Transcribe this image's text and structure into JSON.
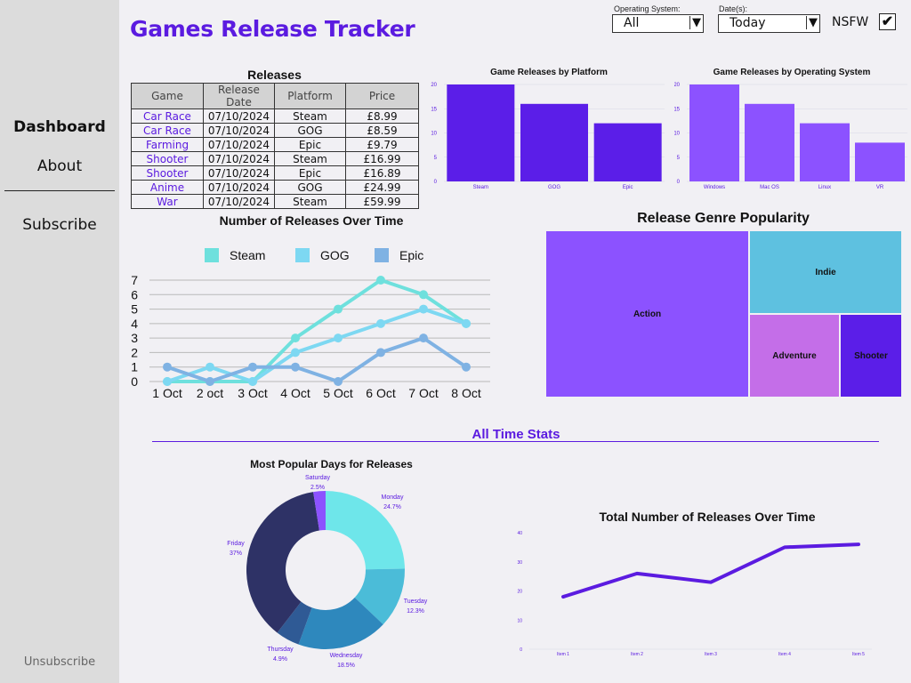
{
  "title": "Games Release Tracker",
  "nav": {
    "dashboard": "Dashboard",
    "about": "About",
    "subscribe": "Subscribe",
    "unsubscribe": "Unsubscribe"
  },
  "filters": {
    "os_label": "Operating System:",
    "os_value": "All",
    "date_label": "Date(s):",
    "date_value": "Today",
    "nsfw_label": "NSFW",
    "nsfw_checked": true,
    "check_glyph": "✔",
    "caret_glyph": "▼"
  },
  "releases_table": {
    "title": "Releases",
    "headers": [
      "Game",
      "Release Date",
      "Platform",
      "Price"
    ],
    "rows": [
      [
        "Car Race",
        "07/10/2024",
        "Steam",
        "£8.99"
      ],
      [
        "Car Race",
        "07/10/2024",
        "GOG",
        "£8.59"
      ],
      [
        "Farming",
        "07/10/2024",
        "Epic",
        "£9.79"
      ],
      [
        "Shooter",
        "07/10/2024",
        "Steam",
        "£16.99"
      ],
      [
        "Shooter",
        "07/10/2024",
        "Epic",
        "£16.89"
      ],
      [
        "Anime",
        "07/10/2024",
        "GOG",
        "£24.99"
      ],
      [
        "War",
        "07/10/2024",
        "Steam",
        "£59.99"
      ]
    ]
  },
  "colors": {
    "accent": "#5b1be0",
    "platform_bar": "#5b1ee8",
    "os_bar": "#8c52ff",
    "steam": "#6ee0dd",
    "gog": "#7dd8f2",
    "epic": "#7fb2e3",
    "total_line": "#5b1be0"
  },
  "section": {
    "all_time_stats": "All Time Stats"
  },
  "chart_data": [
    {
      "id": "platform",
      "type": "bar",
      "title": "Game Releases by Platform",
      "categories": [
        "Steam",
        "GOG",
        "Epic"
      ],
      "values": [
        20,
        16,
        12
      ],
      "ylim": [
        0,
        20
      ],
      "yticks": [
        0,
        5,
        10,
        15,
        20
      ]
    },
    {
      "id": "os",
      "type": "bar",
      "title": "Game Releases by Operating System",
      "categories": [
        "Windows",
        "Mac OS",
        "Linux",
        "VR"
      ],
      "values": [
        20,
        16,
        12,
        8
      ],
      "ylim": [
        0,
        20
      ],
      "yticks": [
        0,
        5,
        10,
        15,
        20
      ]
    },
    {
      "id": "over_time",
      "type": "line",
      "title": "Number of Releases Over Time",
      "x": [
        "1 Oct",
        "2 oct",
        "3 Oct",
        "4 Oct",
        "5 Oct",
        "6 Oct",
        "7 Oct",
        "8 Oct"
      ],
      "series": [
        {
          "name": "Steam",
          "values": [
            0,
            0,
            0,
            3,
            5,
            7,
            6,
            4
          ]
        },
        {
          "name": "GOG",
          "values": [
            0,
            1,
            0,
            2,
            3,
            4,
            5,
            4
          ]
        },
        {
          "name": "Epic",
          "values": [
            1,
            0,
            1,
            1,
            0,
            2,
            3,
            1
          ]
        }
      ],
      "ylim": [
        0,
        7
      ],
      "yticks": [
        0,
        1,
        2,
        3,
        4,
        5,
        6,
        7
      ],
      "legend": "top",
      "grid": true
    },
    {
      "id": "genre",
      "type": "treemap",
      "title": "Release Genre Popularity",
      "items": [
        {
          "label": "Action",
          "color": "#8c52ff"
        },
        {
          "label": "Indie",
          "color": "#5ec1e0"
        },
        {
          "label": "Adventure",
          "color": "#c46ee8"
        },
        {
          "label": "Shooter",
          "color": "#5b1ee8"
        }
      ]
    },
    {
      "id": "days",
      "type": "pie",
      "donut": true,
      "title": "Most Popular Days for Releases",
      "slices": [
        {
          "label": "Monday",
          "pct": "24.7%",
          "value": 24.7,
          "color": "#6ee6ea"
        },
        {
          "label": "Tuesday",
          "pct": "12.3%",
          "value": 12.3,
          "color": "#4bbcd8"
        },
        {
          "label": "Wednesday",
          "pct": "18.5%",
          "value": 18.5,
          "color": "#2e88bd"
        },
        {
          "label": "Thursday",
          "pct": "4.9%",
          "value": 4.9,
          "color": "#2f5a95"
        },
        {
          "label": "Friday",
          "pct": "37%",
          "value": 37,
          "color": "#2e3266"
        },
        {
          "label": "Saturday",
          "pct": "2.5%",
          "value": 2.5,
          "color": "#8c52ff"
        }
      ]
    },
    {
      "id": "total",
      "type": "line",
      "title": "Total Number of Releases Over Time",
      "x": [
        "Item 1",
        "Item 2",
        "Item 3",
        "Item 4",
        "Item 5"
      ],
      "values": [
        18,
        26,
        23,
        35,
        36
      ],
      "ylim": [
        0,
        40
      ],
      "yticks": [
        0,
        10,
        20,
        30,
        40
      ]
    }
  ]
}
